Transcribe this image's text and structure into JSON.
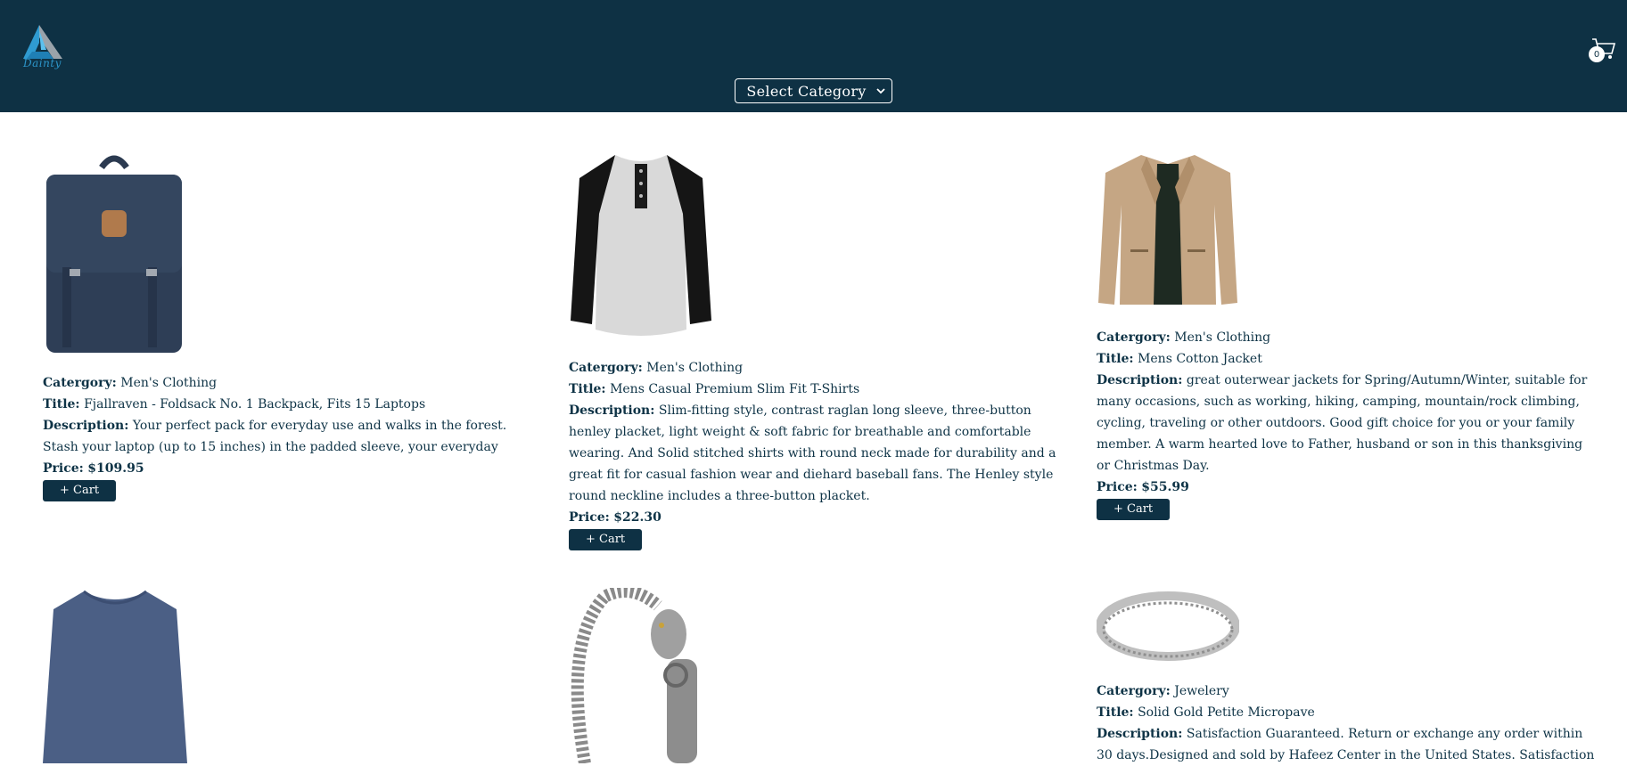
{
  "header": {
    "logo_text": "Dainty",
    "category_select": "Select Category",
    "cart_count": "0"
  },
  "labels": {
    "category": "Catergory:",
    "title": "Title:",
    "description": "Description:",
    "price": "Price:",
    "cart_button": "+ Cart"
  },
  "products": [
    {
      "category": "Men's Clothing",
      "title": "Fjallraven - Foldsack No. 1 Backpack, Fits 15 Laptops",
      "description": "Your perfect pack for everyday use and walks in the forest. Stash your laptop (up to 15 inches) in the padded sleeve, your everyday",
      "price": "$109.95"
    },
    {
      "category": "Men's Clothing",
      "title": "Mens Casual Premium Slim Fit T-Shirts",
      "description": "Slim-fitting style, contrast raglan long sleeve, three-button henley placket, light weight & soft fabric for breathable and comfortable wearing. And Solid stitched shirts with round neck made for durability and a great fit for casual fashion wear and diehard baseball fans. The Henley style round neckline includes a three-button placket.",
      "price": "$22.30"
    },
    {
      "category": "Men's Clothing",
      "title": "Mens Cotton Jacket",
      "description": "great outerwear jackets for Spring/Autumn/Winter, suitable for many occasions, such as working, hiking, camping, mountain/rock climbing, cycling, traveling or other outdoors. Good gift choice for you or your family member. A warm hearted love to Father, husband or son in this thanksgiving or Christmas Day.",
      "price": "$55.99"
    },
    {
      "category": "Jewelery",
      "title": "Solid Gold Petite Micropave",
      "description": "Satisfaction Guaranteed. Return or exchange any order within 30 days.Designed and sold by Hafeez Center in the United States. Satisfaction"
    }
  ]
}
